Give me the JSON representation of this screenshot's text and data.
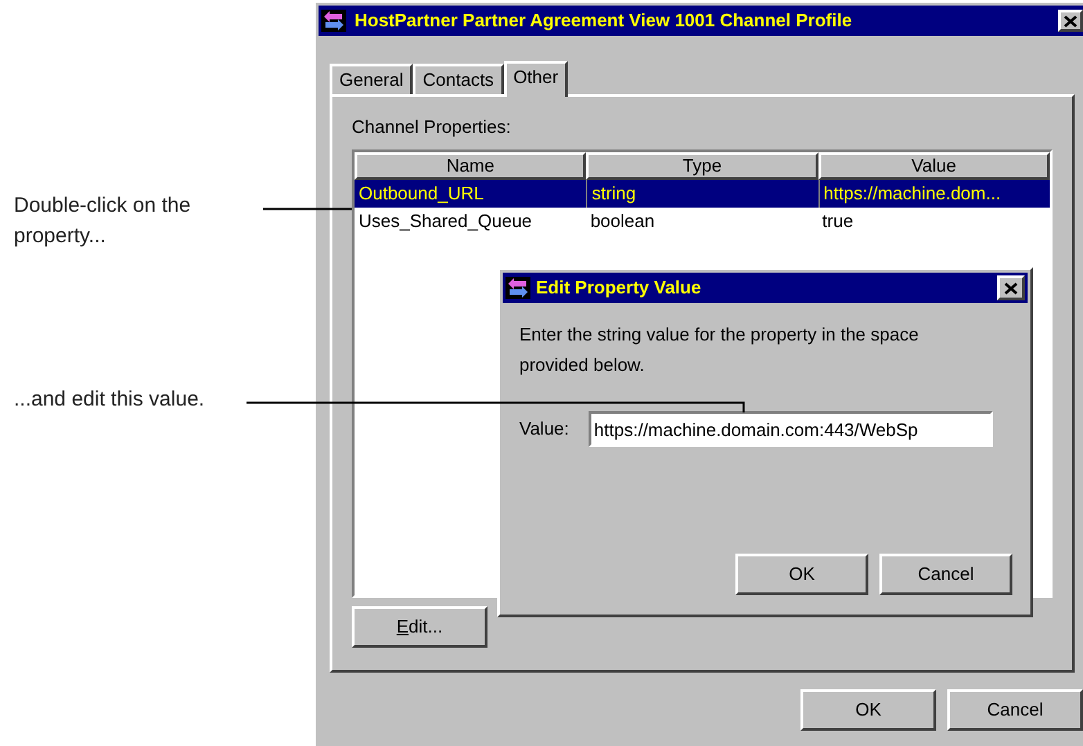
{
  "callouts": [
    "Double-click on the property...",
    "...and edit this value."
  ],
  "window": {
    "title": "HostPartner Partner Agreement View 1001 Channel Profile"
  },
  "tabs": [
    {
      "label": "General",
      "selected": false
    },
    {
      "label": "Contacts",
      "selected": false
    },
    {
      "label": "Other",
      "selected": true
    }
  ],
  "properties_label": "Channel Properties:",
  "table": {
    "columns": [
      "Name",
      "Type",
      "Value"
    ],
    "rows": [
      {
        "cells": [
          "Outbound_URL",
          "string",
          "https://machine.dom..."
        ],
        "selected": true
      },
      {
        "cells": [
          "Uses_Shared_Queue",
          "boolean",
          "true"
        ],
        "selected": false
      }
    ]
  },
  "edit_button": {
    "label": "Edit..."
  },
  "dialog": {
    "title": "Edit Property Value",
    "message": "Enter the string value for the property in the space provided below.",
    "field_label": "Value:",
    "field_value": "https://machine.domain.com:443/WebSp",
    "buttons": [
      "OK",
      "Cancel"
    ]
  },
  "buttons": [
    "OK",
    "Cancel"
  ]
}
